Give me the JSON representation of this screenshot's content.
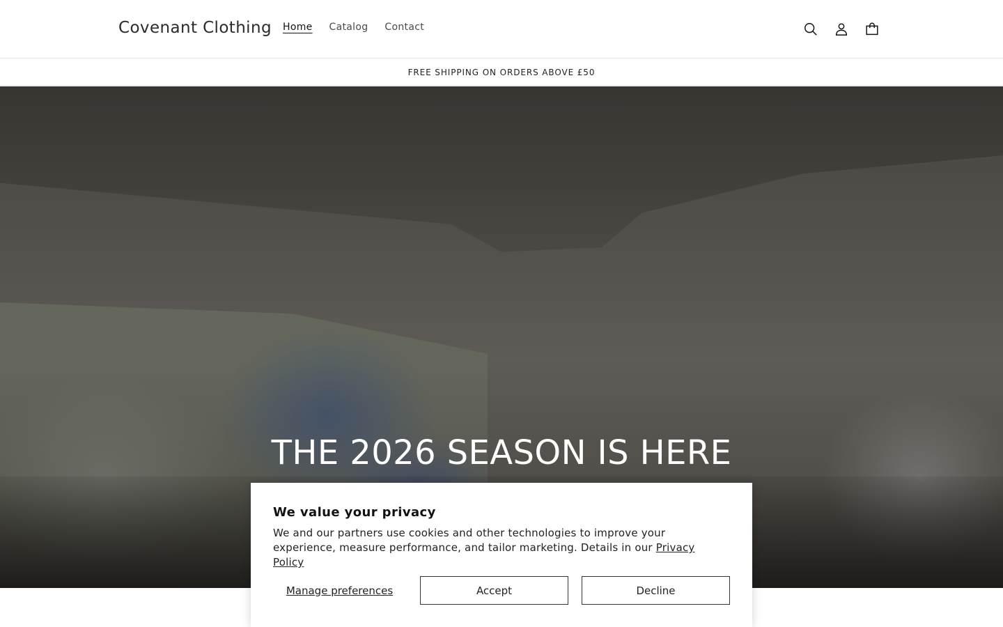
{
  "header": {
    "logo": "Covenant Clothing",
    "nav": [
      {
        "label": "Home",
        "active": true
      },
      {
        "label": "Catalog",
        "active": false
      },
      {
        "label": "Contact",
        "active": false
      }
    ],
    "icons": [
      "search-icon",
      "account-icon",
      "cart-icon"
    ]
  },
  "announcement": {
    "text": "FREE SHIPPING ON ORDERS ABOVE £50"
  },
  "hero": {
    "title": "THE 2026 SEASON IS HERE"
  },
  "cookie_banner": {
    "title": "We value your privacy",
    "body": "We and our partners use cookies and other technologies to improve your experience, measure performance, and tailor marketing. Details in our",
    "privacy_link": "Privacy Policy",
    "manage_label": "Manage preferences",
    "accept_label": "Accept",
    "decline_label": "Decline"
  },
  "colors": {
    "text": "#121212",
    "border": "#e6e6e6",
    "button_border": "#333333"
  }
}
